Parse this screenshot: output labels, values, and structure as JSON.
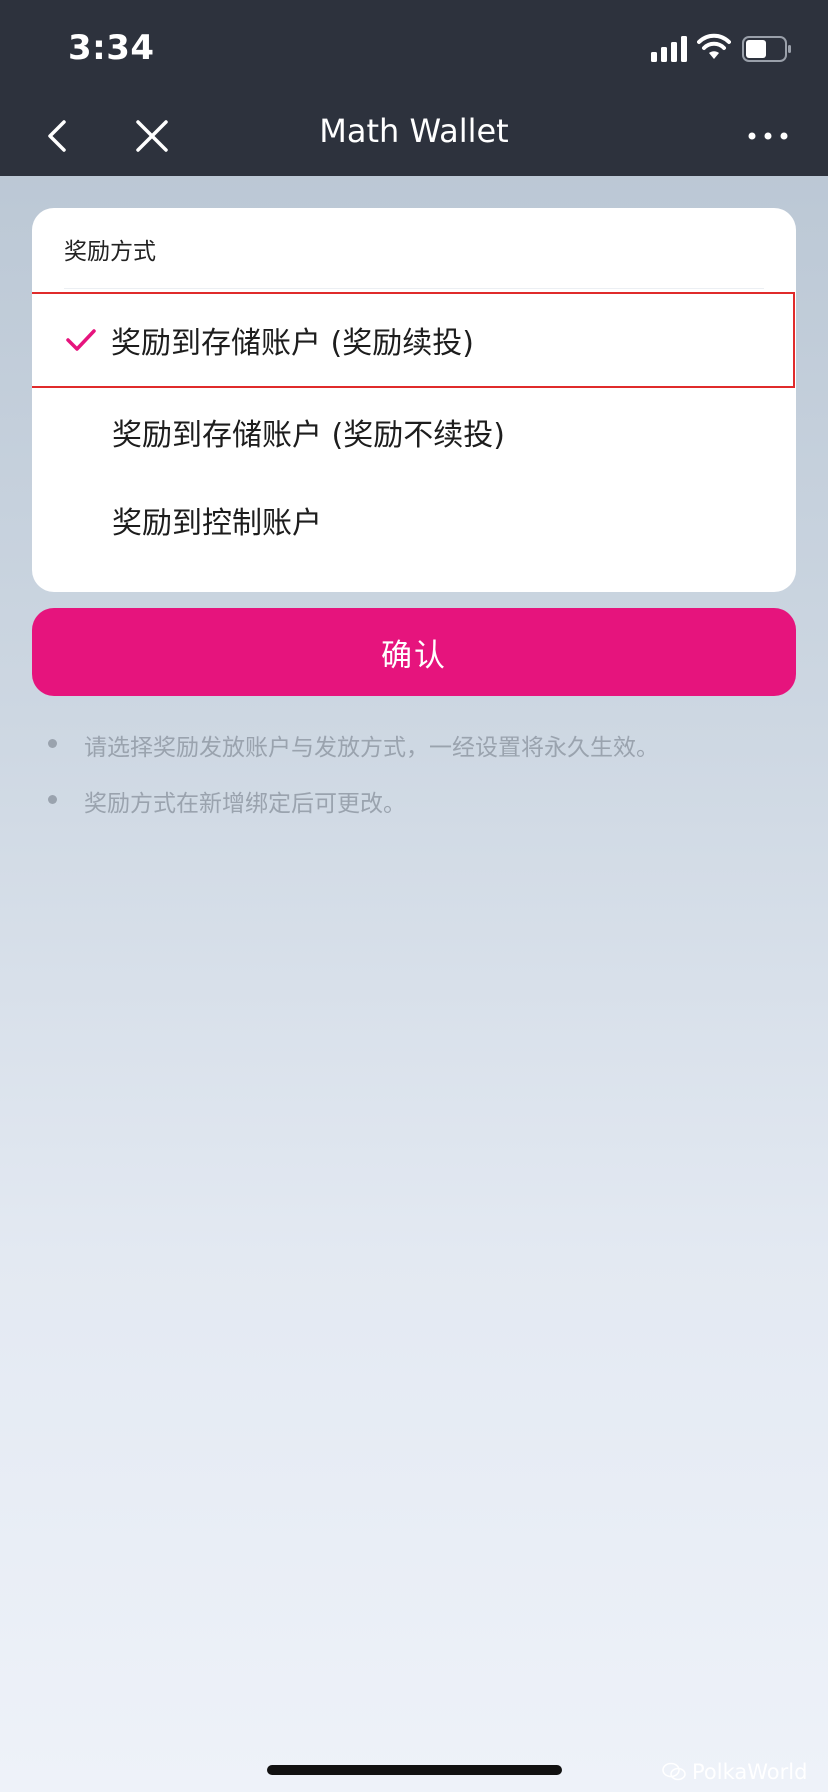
{
  "status_bar": {
    "time": "3:34"
  },
  "nav": {
    "title": "Math Wallet"
  },
  "card": {
    "title": "奖励方式",
    "options": [
      {
        "label": "奖励到存储账户 (奖励续投)",
        "selected": true
      },
      {
        "label": "奖励到存储账户 (奖励不续投)",
        "selected": false
      },
      {
        "label": "奖励到控制账户",
        "selected": false
      }
    ]
  },
  "confirm_label": "确认",
  "notes": [
    "请选择奖励发放账户与发放方式，一经设置将永久生效。",
    "奖励方式在新增绑定后可更改。"
  ],
  "watermark": "PolkaWorld",
  "colors": {
    "accent": "#e6147d",
    "header": "#2d323d",
    "highlight_border": "#e02b2b"
  }
}
